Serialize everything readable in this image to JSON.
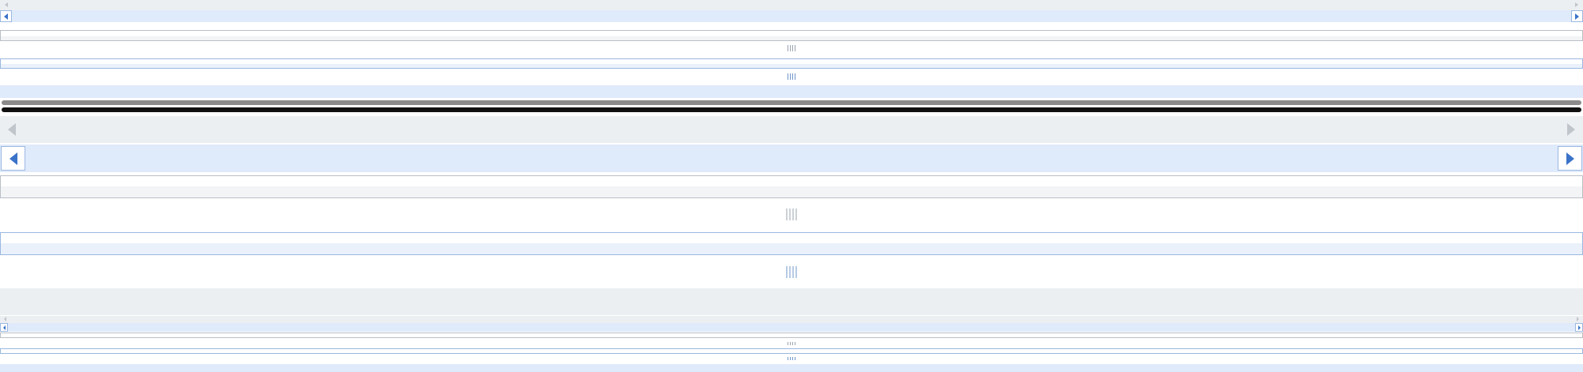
{
  "colors": {
    "track_grey": "#eceff2",
    "track_blue": "#dfeafb",
    "arrow_blue": "#3a73c8",
    "arrow_grey": "#bfc5cb",
    "bar_dark": "#111111",
    "bar_mid": "#8b8b8b"
  },
  "icons": {
    "arrow_left": "chevron-left-icon",
    "arrow_right": "chevron-right-icon",
    "grip": "grip-lines-icon"
  },
  "scrollbars": {
    "small_horizontal_grey": "scrollbar-small-grey",
    "small_horizontal_blue": "scrollbar-small-blue",
    "large_horizontal_grey": "scrollbar-large-grey",
    "large_horizontal_blue": "scrollbar-large-blue"
  }
}
